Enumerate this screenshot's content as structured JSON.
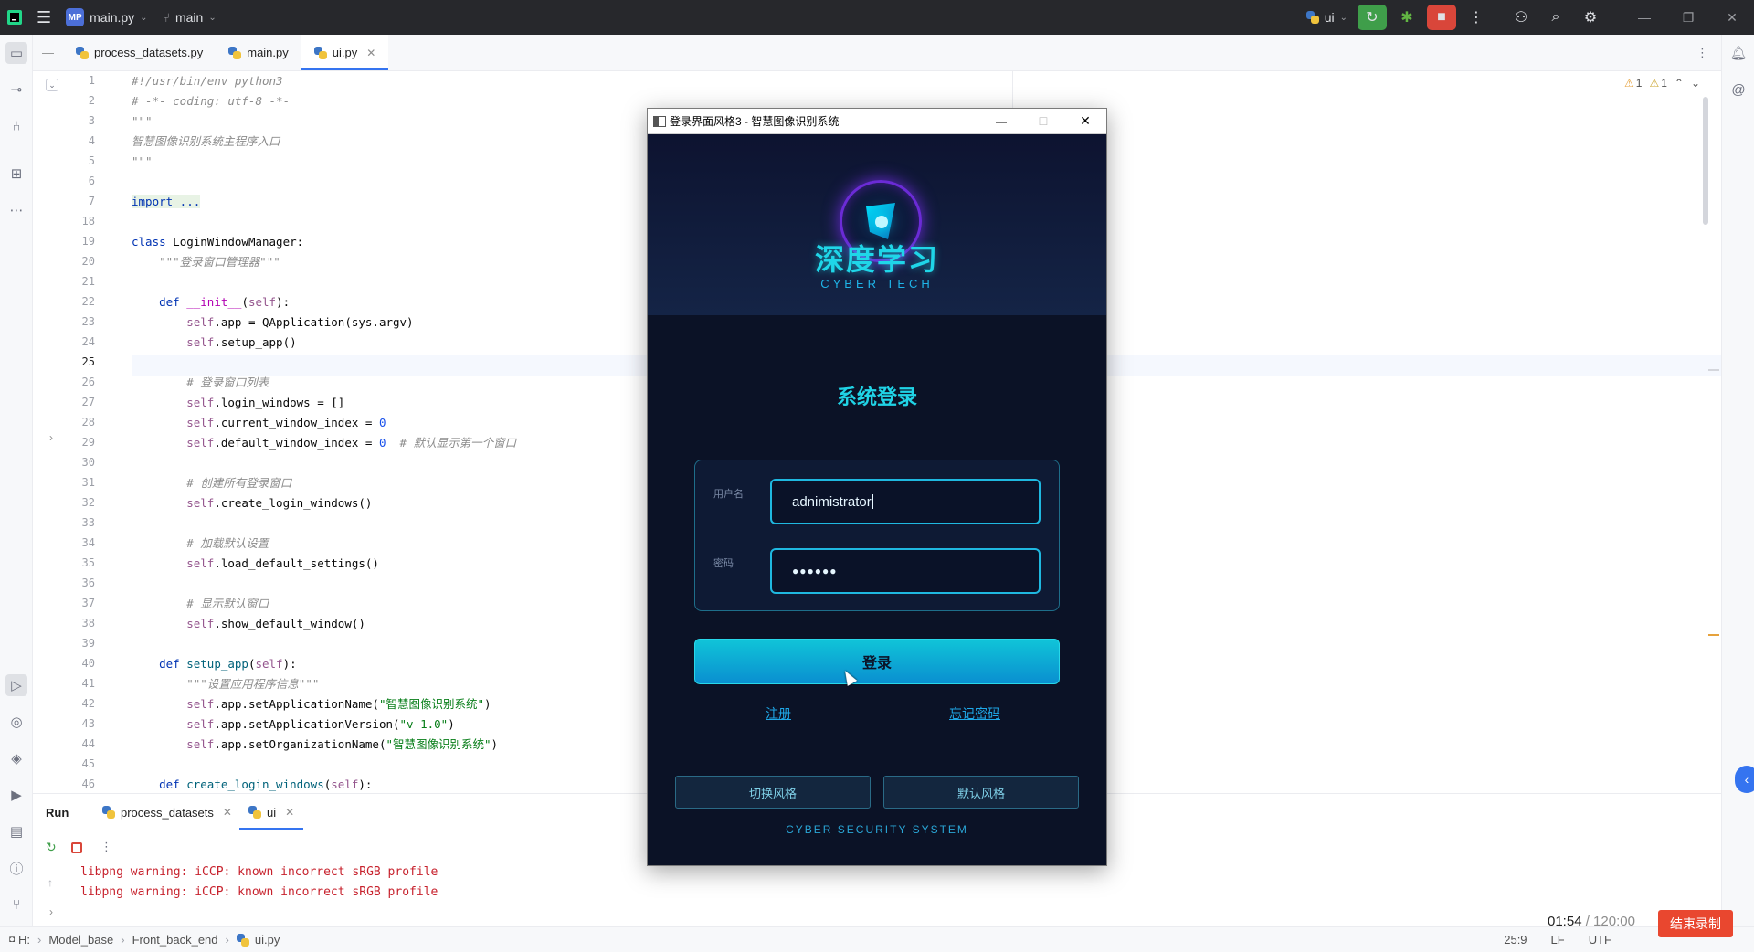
{
  "topbar": {
    "project_badge": "MP",
    "project_file": "main.py",
    "branch": "main",
    "interpreter": "ui"
  },
  "editor_tabs": [
    {
      "label": "process_datasets.py"
    },
    {
      "label": "main.py"
    },
    {
      "label": "ui.py"
    }
  ],
  "code": {
    "line_numbers": [
      "1",
      "2",
      "3",
      "4",
      "5",
      "6",
      "7",
      "18",
      "19",
      "20",
      "21",
      "22",
      "23",
      "24",
      "25",
      "26",
      "27",
      "28",
      "29",
      "30",
      "31",
      "32",
      "33",
      "34",
      "35",
      "36",
      "37",
      "38",
      "39",
      "40",
      "41",
      "42",
      "43",
      "44",
      "45",
      "46"
    ],
    "inspections": {
      "warnings": "1",
      "weak_warnings": "1"
    }
  },
  "run_panel": {
    "title": "Run",
    "tabs": [
      {
        "label": "process_datasets"
      },
      {
        "label": "ui"
      }
    ],
    "output": [
      "libpng warning: iCCP: known incorrect sRGB profile",
      "libpng warning: iCCP: known incorrect sRGB profile"
    ]
  },
  "statusbar": {
    "drive": "H:",
    "path": [
      "Model_base",
      "Front_back_end",
      "ui.py"
    ],
    "position": "25:9",
    "line_sep": "LF",
    "encoding": "UTF"
  },
  "recording": {
    "elapsed": "01:54",
    "total": "/ 120:00",
    "stop_label": "结束录制"
  },
  "dialog": {
    "title": "登录界面风格3 - 智慧图像识别系统",
    "brand_cn": "深度学习",
    "brand_en": "CYBER TECH",
    "login_title": "系统登录",
    "username_label": "用户名",
    "username_value": "adnimistrator",
    "password_label": "密码",
    "password_mask": "●●●●●●",
    "login_button": "登录",
    "register_link": "注册",
    "forgot_link": "忘记密码",
    "switch_style_button": "切换风格",
    "default_style_button": "默认风格",
    "footer": "CYBER SECURITY SYSTEM"
  },
  "colors": {
    "accent_blue": "#3574f0",
    "dialog_bg": "#0b1226",
    "cyan": "#1fd6e8",
    "record_red": "#e9472f"
  }
}
